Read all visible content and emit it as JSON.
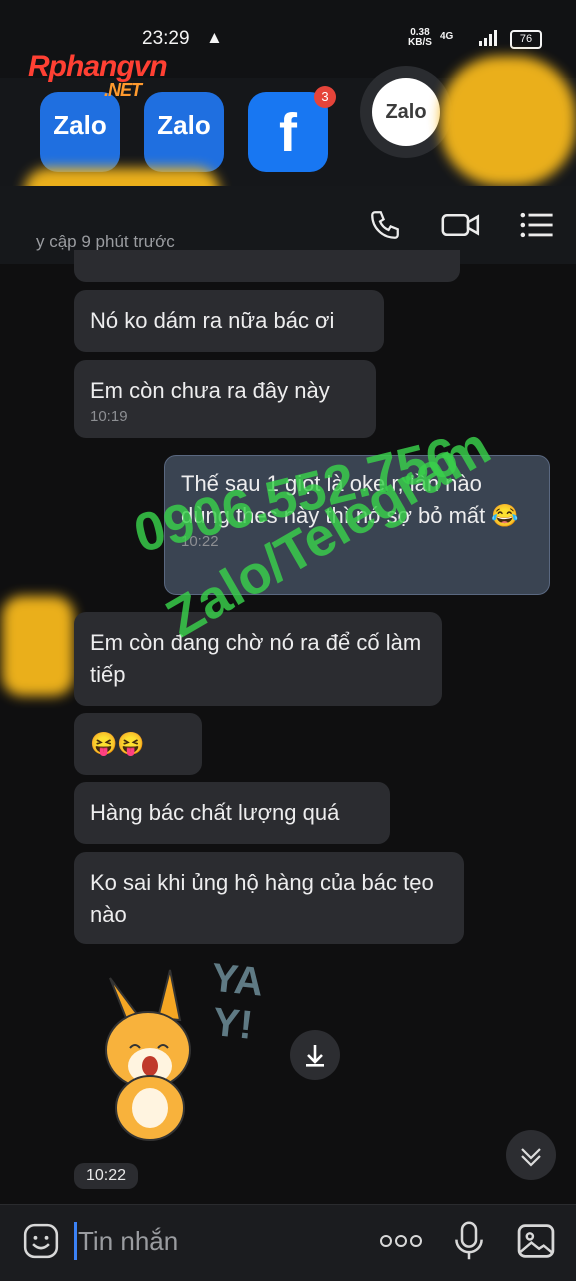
{
  "status_bar": {
    "time": "23:29",
    "alert": "▲",
    "speed_value": "0.38",
    "speed_unit": "KB/S",
    "network": "4G",
    "battery": "76"
  },
  "brand": {
    "name": "Rphangvn",
    "suffix": ".NET"
  },
  "recent_apps": [
    {
      "name": "Zalo",
      "icon": "zalo-icon"
    },
    {
      "name": "Zalo",
      "icon": "zalo-icon"
    },
    {
      "name": "f",
      "icon": "facebook-icon",
      "badge": "3"
    }
  ],
  "floating_bubble": {
    "label": "Zalo"
  },
  "header": {
    "last_seen": "y cập 9 phút trước",
    "icons": [
      "phone-icon",
      "video-call-icon",
      "menu-icon"
    ]
  },
  "messages": [
    {
      "text": "Nó ko dám ra nữa bác ơi"
    },
    {
      "text": "Em còn chưa ra đây này",
      "time": "10:19"
    },
    {
      "text": "Thế sau 1 giọt là oke r, lần nào dùng thes này thì nó sợ bỏ mất 😂",
      "time": "10:22",
      "mine": true
    },
    {
      "text": "Em còn đang chờ nó ra để cố làm tiếp"
    },
    {
      "text": "😝😝"
    },
    {
      "text": "Hàng bác chất lượng quá"
    },
    {
      "text": "Ko sai khi ủng hộ hàng của bác tẹo nào"
    }
  ],
  "sticker": {
    "text": "YAY!"
  },
  "time_chip": "10:22",
  "watermark": {
    "phone": "0906.552.756",
    "apps": "Zalo/Telegram"
  },
  "composer": {
    "placeholder": "Tin nhắn",
    "icons": [
      "emoji-icon",
      "more-icon",
      "microphone-icon",
      "image-icon"
    ]
  },
  "colors": {
    "accent": "#3b82f6",
    "watermark": "#39d14b",
    "bubble": "#2b2c30",
    "outgoing": "#3a4452"
  }
}
